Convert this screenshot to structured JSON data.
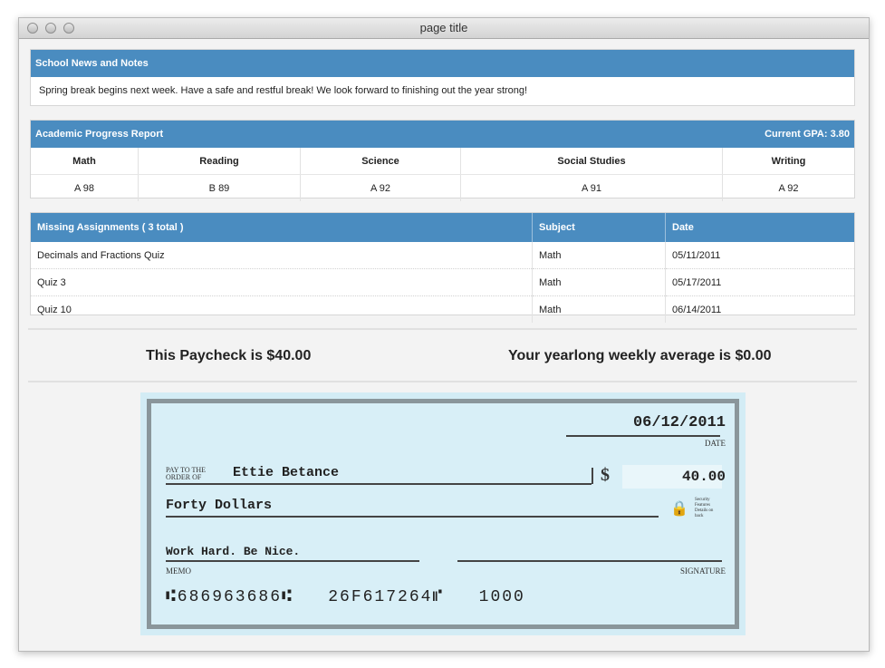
{
  "window": {
    "title": "page title"
  },
  "news": {
    "header": "School News and Notes",
    "body": "Spring break begins next week. Have a safe and restful break! We look forward to finishing out the year strong!"
  },
  "progress": {
    "header": "Academic Progress Report",
    "gpa": "Current GPA: 3.80",
    "subjects": [
      {
        "name": "Math",
        "grade": "A 98"
      },
      {
        "name": "Reading",
        "grade": "B 89"
      },
      {
        "name": "Science",
        "grade": "A 92"
      },
      {
        "name": "Social Studies",
        "grade": "A 91"
      },
      {
        "name": "Writing",
        "grade": "A 92"
      }
    ]
  },
  "missing": {
    "header": "Missing Assignments   ( 3 total )",
    "col_subject": "Subject",
    "col_date": "Date",
    "rows": [
      {
        "name": "Decimals and Fractions Quiz",
        "subject": "Math",
        "date": "05/11/2011"
      },
      {
        "name": "Quiz 3",
        "subject": "Math",
        "date": "05/17/2011"
      },
      {
        "name": "Quiz 10",
        "subject": "Math",
        "date": "06/14/2011"
      }
    ]
  },
  "paycheck": {
    "this_paycheck": "This Paycheck is $40.00",
    "weekly_average": "Your yearlong weekly average is $0.00"
  },
  "check": {
    "date": "06/12/2011",
    "date_label": "DATE",
    "pay_to_label_1": "PAY TO THE",
    "pay_to_label_2": "ORDER OF",
    "payee": "Ettie Betance",
    "dollar_sign": "$",
    "amount": "40.00",
    "written_amount": "Forty Dollars",
    "security_1": "Security",
    "security_2": "Features",
    "security_3": "Details on",
    "security_4": "back",
    "memo": "Work Hard. Be Nice.",
    "memo_label": "MEMO",
    "signature_label": "SIGNATURE",
    "micr": "⑆686963686⑆   26F617264⑈   1000",
    "colors": {
      "accent": "#4a8cc0",
      "check_bg": "#d3ecf5",
      "check_border": "#8a969b"
    }
  }
}
